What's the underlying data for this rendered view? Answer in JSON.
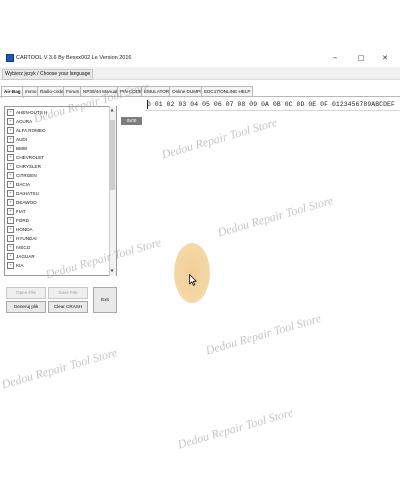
{
  "window": {
    "title": "CARTOOL V 3.6 By Bexxx002 Le Version 2016",
    "minimize_glyph": "–",
    "maximize_glyph": "□",
    "close_glyph": "✕"
  },
  "menu": {
    "language_label": "Wybierz język / Choose your language"
  },
  "tabs": [
    {
      "label": "Air-Bag",
      "active": true
    },
    {
      "label": "Immo",
      "active": false
    },
    {
      "label": "Radio-codes",
      "active": false
    },
    {
      "label": "Forum",
      "active": false
    },
    {
      "label": "NP30/44 Manuals",
      "active": false
    },
    {
      "label": "PIN CODE",
      "active": false
    },
    {
      "label": "EMULATORS",
      "active": false
    },
    {
      "label": "Online DUMPS",
      "active": false
    },
    {
      "label": "EDC17/ONLINE HELP",
      "active": false
    }
  ],
  "tree": {
    "items": [
      "AHEN-DUTS H",
      "ACURA",
      "ALFA ROMEO",
      "AUDI",
      "BMW",
      "CHEVROLET",
      "CHRYSLER",
      "CITROEN",
      "DACIA",
      "DAIHATSU",
      "DEAWOO",
      "FIAT",
      "FORD",
      "HONDA",
      "HYUNDAI",
      "IVECO",
      "JAGUAR",
      "KIA"
    ],
    "expander_glyph": "+",
    "scroll_up_glyph": "▲",
    "scroll_down_glyph": "▼"
  },
  "buttons": {
    "open_file": "Open File",
    "save_file": "Save File",
    "generate": "Generuj plik",
    "clear_crash": "Clear CRASH",
    "exit": "Exit"
  },
  "hex_editor": {
    "address_label": "0x00",
    "header": "0 01 02 03 04 05 06 07 08 09 0A 0B 0C 0D 0E 0F  0123456789ABCDEF"
  },
  "watermark": "Dedou Repair Tool Store",
  "colors": {
    "accent_icon": "#1e5aa8",
    "click_highlight": "#f0c98a",
    "address_label_bg": "#7d7d7d"
  }
}
